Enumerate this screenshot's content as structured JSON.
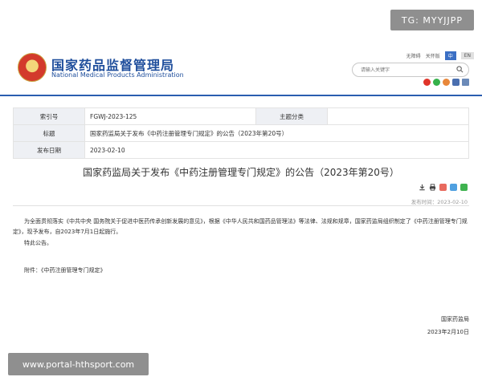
{
  "watermarks": {
    "top": "TG: MYYJJPP",
    "bottom": "www.portal-hthsport.com"
  },
  "header": {
    "site_name_cn": "国家药品监督管理局",
    "site_name_en": "National Medical Products Administration",
    "links": {
      "accessibility": "无障碍",
      "follow": "关怀版",
      "lang_cn": "中",
      "lang_en": "EN"
    },
    "search": {
      "placeholder": "请输入关键字"
    },
    "social_icons": [
      "weibo-icon",
      "wechat-icon",
      "heart-icon",
      "mobile-icon",
      "email-icon"
    ]
  },
  "meta": {
    "index_label": "索引号",
    "index_value": "FGWJ-2023-125",
    "category_label": "主题分类",
    "category_value": "",
    "title_label": "标题",
    "title_value": "国家药监局关于发布《中药注册管理专门规定》的公告（2023年第20号）",
    "date_label": "发布日期",
    "date_value": "2023-02-10"
  },
  "article": {
    "title": "国家药监局关于发布《中药注册管理专门规定》的公告（2023年第20号）",
    "publish_time": "发布时间：2023-02-10",
    "paragraph_1": "为全面贯彻落实《中共中央 国务院关于促进中医药传承创新发展的意见》，根据《中华人民共和国药品管理法》等法律、法规和规章，国家药监局组织制定了《中药注册管理专门规定》，现予发布，自2023年7月1日起施行。",
    "paragraph_2": "特此公告。",
    "attachment": "附件：《中药注册管理专门规定》",
    "signature_org": "国家药监局",
    "signature_date": "2023年2月10日"
  },
  "colors": {
    "brand_blue": "#2a5db0",
    "label_bg": "#eef0f4"
  }
}
